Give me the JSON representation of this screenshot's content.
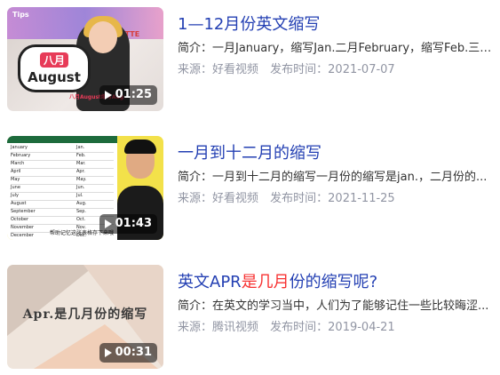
{
  "results": [
    {
      "title": "1—12月份英文缩写",
      "title_highlight": "",
      "summary": "简介：一月January，缩写Jan.二月February，缩写Feb.三月...",
      "source": "来源：好看视频",
      "publish": "发布时间：2021-07-07",
      "duration": "01:25",
      "thumb": {
        "logo": "Tips",
        "brand": "LATTE",
        "card_zh": "八月",
        "card_en": "August",
        "caption": "八月August缩写Aug"
      }
    },
    {
      "title": "一月到十二月的缩写",
      "title_highlight": "",
      "summary": "简介：一月到十二月的缩写一月份的缩写是jan.，二月份的...",
      "source": "来源：好看视频",
      "publish": "发布时间：2021-11-25",
      "duration": "01:43",
      "thumb": {
        "months": [
          {
            "m": "January",
            "a": "Jan."
          },
          {
            "m": "February",
            "a": "Feb."
          },
          {
            "m": "March",
            "a": "Mar."
          },
          {
            "m": "April",
            "a": "Apr."
          },
          {
            "m": "May",
            "a": "May."
          },
          {
            "m": "June",
            "a": "Jun."
          },
          {
            "m": "July",
            "a": "Jul."
          },
          {
            "m": "August",
            "a": "Aug."
          },
          {
            "m": "September",
            "a": "Sep."
          },
          {
            "m": "October",
            "a": "Oct."
          },
          {
            "m": "November",
            "a": "Nov."
          },
          {
            "m": "December",
            "a": "Dec."
          }
        ],
        "subtitle": "帮助记忆这张表格存下来哦"
      }
    },
    {
      "title_prefix": "英文APR",
      "title_highlight": "是几月",
      "title_suffix": "份的缩写呢?",
      "summary": "简介：在英文的学习当中，人们为了能够记住一些比较晦涩...",
      "source": "来源：腾讯视频",
      "publish": "发布时间：2019-04-21",
      "duration": "00:31",
      "thumb": {
        "text": "Apr.是几月份的缩写"
      }
    }
  ],
  "colors": {
    "title": "#2440b3",
    "highlight": "#f73131",
    "meta": "#9195a3"
  }
}
